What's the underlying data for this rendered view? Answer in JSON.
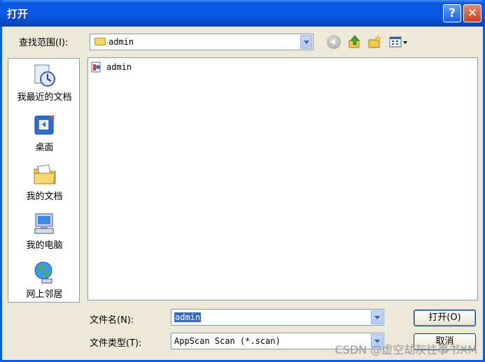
{
  "window": {
    "title": "打开",
    "help_glyph": "?",
    "close_glyph": "✕"
  },
  "lookin": {
    "label": "查找范围(I):",
    "value": "admin"
  },
  "places": [
    {
      "label": "我最近的文档"
    },
    {
      "label": "桌面"
    },
    {
      "label": "我的文档"
    },
    {
      "label": "我的电脑"
    },
    {
      "label": "网上邻居"
    }
  ],
  "files": [
    {
      "name": "admin"
    }
  ],
  "filename": {
    "label": "文件名(N):",
    "value": "admin"
  },
  "filetype": {
    "label": "文件类型(T):",
    "value": "AppScan Scan (*.scan)"
  },
  "buttons": {
    "open": "打开(O)",
    "cancel": "取消"
  },
  "watermark": "CSDN @虚空劫灰往事书XM",
  "colors": {
    "titlebar": "#0a5ae6",
    "selection": "#316ac5",
    "face": "#ece9d8"
  }
}
